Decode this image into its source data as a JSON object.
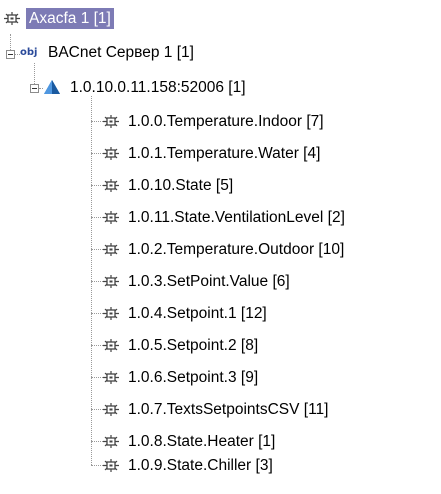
{
  "tree": {
    "root": {
      "label": "Axacfa 1 [1]",
      "icon": "sensor-chip-icon",
      "selected": true
    },
    "server": {
      "label": "BACnet Сервер 1 [1]",
      "icon_text": "obj"
    },
    "device": {
      "label": "1.0.10.0.11.158:52006 [1]",
      "icon": "blue-pyramid-icon"
    },
    "points": [
      {
        "label": "1.0.0.Temperature.Indoor [7]"
      },
      {
        "label": "1.0.1.Temperature.Water [4]"
      },
      {
        "label": "1.0.10.State [5]"
      },
      {
        "label": "1.0.11.State.VentilationLevel [2]"
      },
      {
        "label": "1.0.2.Temperature.Outdoor [10]"
      },
      {
        "label": "1.0.3.SetPoint.Value [6]"
      },
      {
        "label": "1.0.4.Setpoint.1 [12]"
      },
      {
        "label": "1.0.5.Setpoint.2 [8]"
      },
      {
        "label": "1.0.6.Setpoint.3 [9]"
      },
      {
        "label": "1.0.7.TextsSetpointsCSV [11]"
      },
      {
        "label": "1.0.8.State.Heater [1]"
      },
      {
        "label": "1.0.9.State.Chiller [3]"
      }
    ],
    "colors": {
      "selection": "#7d7bb5",
      "pyramid": "#1f6fc0",
      "obj_text": "#2a4a9a",
      "guide": "#9a9a9a"
    }
  }
}
